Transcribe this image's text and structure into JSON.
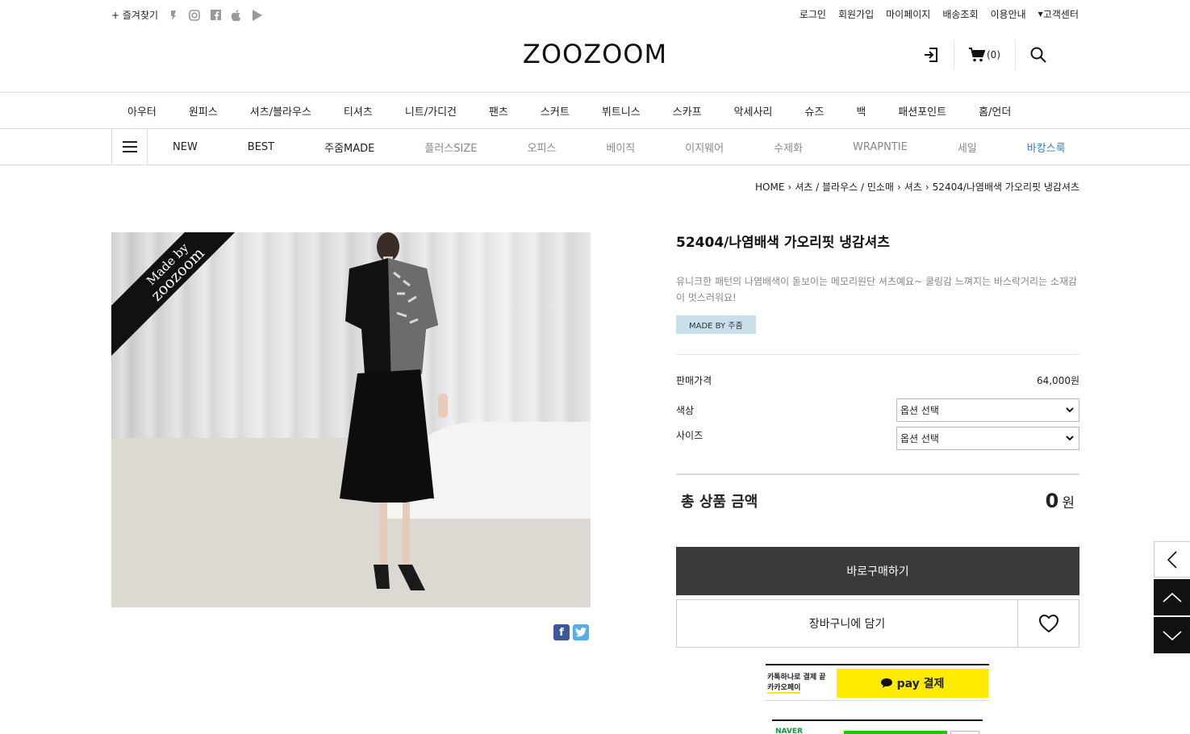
{
  "util": {
    "bookmark": "+ 즐겨찾기",
    "links": [
      "로그인",
      "회원가입",
      "마이페이지",
      "배송조회",
      "이용안내",
      "고객센터"
    ]
  },
  "brand": {
    "logo": "ZOOZOOM"
  },
  "header": {
    "cart_count": "(0)"
  },
  "nav_main": [
    "아우터",
    "원피스",
    "셔츠/블라우스",
    "티셔츠",
    "니트/가디건",
    "팬츠",
    "스커트",
    "뷔트니스",
    "스카프",
    "악세사리",
    "슈즈",
    "백",
    "패션포인트",
    "홈/언더"
  ],
  "nav_sub": [
    {
      "label": "NEW",
      "style": "dark"
    },
    {
      "label": "BEST",
      "style": "dark"
    },
    {
      "label": "주줌MADE",
      "style": "dark"
    },
    {
      "label": "플러스SIZE",
      "style": "grey"
    },
    {
      "label": "오피스",
      "style": "grey"
    },
    {
      "label": "베이직",
      "style": "grey"
    },
    {
      "label": "이지웨어",
      "style": "grey"
    },
    {
      "label": "수제화",
      "style": "grey"
    },
    {
      "label": "WRAPNTIE",
      "style": "grey"
    },
    {
      "label": "세일",
      "style": "grey"
    },
    {
      "label": "바캉스룩",
      "style": "blue"
    }
  ],
  "breadcrumb": {
    "home": "HOME",
    "cat1": "셔츠 / 블라우스 / 민소매",
    "cat2": "셔츠",
    "current": "52404/나염배색 가오리핏 냉감셔츠"
  },
  "image": {
    "ribbon_line1": "Made by",
    "ribbon_line2": "zoozoom"
  },
  "product": {
    "title": "52404/나염배색 가오리핏 냉감셔츠",
    "description": "유니크한 패턴의 나염배색이 돋보이는 메모리원단 셔츠예요~ 쿨링감 느껴지는 바스락거리는 소재감이 멋스러워요!",
    "badge": "MADE BY 주줌",
    "price_label": "판매가격",
    "price": "64,000원",
    "color_label": "색상",
    "size_label": "사이즈",
    "option_placeholder": "옵션 선택",
    "total_label": "총 상품 금액",
    "total_amount": "0",
    "total_unit": "원"
  },
  "actions": {
    "buy_now": "바로구매하기",
    "add_cart": "장바구니에 담기"
  },
  "kakao": {
    "line1": "카톡하나로 결제 끝",
    "line2": "카카오페이",
    "button": "pay 결제"
  },
  "naver": {
    "label": "NAVER"
  },
  "colors": {
    "buy_bg": "#3a3a3a",
    "kakao": "#ffeb00",
    "badge": "#c8dfec",
    "accent_blue": "#3d7bbf"
  }
}
